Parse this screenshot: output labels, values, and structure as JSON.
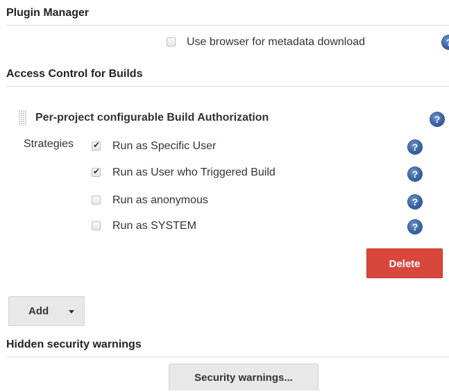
{
  "plugin_manager": {
    "title": "Plugin Manager",
    "metadata_option": {
      "label": "Use browser for metadata download",
      "checked": false
    }
  },
  "access_control": {
    "title": "Access Control for Builds",
    "authorization": {
      "title": "Per-project configurable Build Authorization",
      "strategies_label": "Strategies",
      "strategies": [
        {
          "label": "Run as Specific User",
          "checked": true
        },
        {
          "label": "Run as User who Triggered Build",
          "checked": true
        },
        {
          "label": "Run as anonymous",
          "checked": false
        },
        {
          "label": "Run as SYSTEM",
          "checked": false
        }
      ],
      "delete_label": "Delete"
    },
    "add_label": "Add"
  },
  "hidden_warnings": {
    "title": "Hidden security warnings",
    "button_label": "Security warnings..."
  },
  "help_glyph": "?",
  "check_glyph": "✔",
  "colors": {
    "delete_button": "#d9463b",
    "help_icon": "#3a64a3",
    "neutral_button": "#e8e8e8"
  },
  "icons": [
    "help-icon",
    "drag-handle-icon",
    "dropdown-caret-icon",
    "checkbox"
  ]
}
